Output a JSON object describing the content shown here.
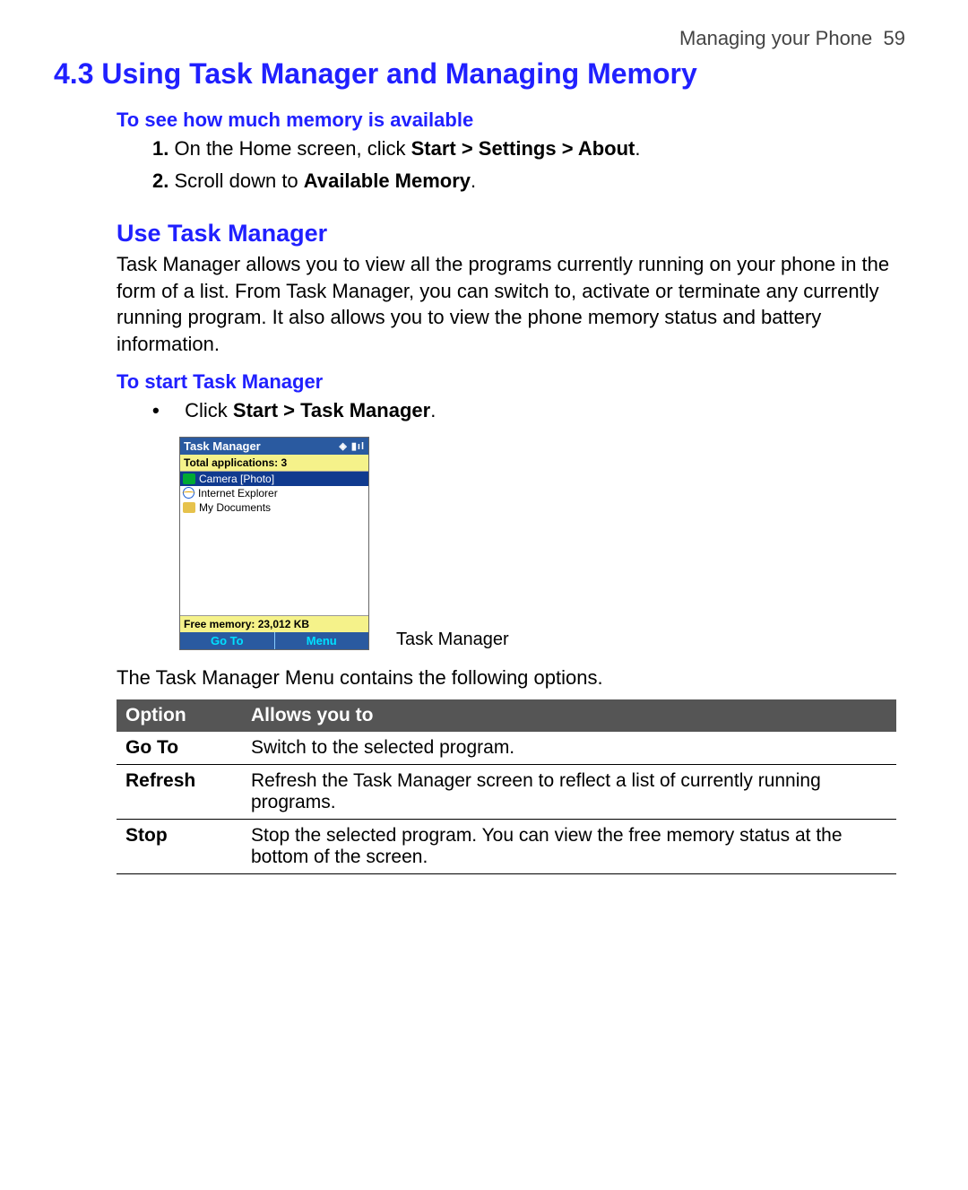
{
  "header": {
    "chapter": "Managing your Phone",
    "page_no": "59"
  },
  "title": "4.3 Using Task Manager and Managing Memory",
  "mem_check": {
    "heading": "To see how much memory is available",
    "steps": [
      {
        "num": "1.",
        "pre": "On the Home screen, click ",
        "bold": "Start > Settings > About",
        "post": "."
      },
      {
        "num": "2.",
        "pre": "Scroll down to ",
        "bold": "Available Memory",
        "post": "."
      }
    ]
  },
  "use_tm": {
    "heading": "Use Task Manager",
    "para": "Task Manager allows you to view all the programs currently running on your phone in the form of a list. From Task Manager, you can switch to, activate or terminate any currently running program. It also allows you to view the phone memory status and battery information."
  },
  "start_tm": {
    "heading": "To start Task Manager",
    "bullet_pre": "Click ",
    "bullet_bold": "Start > Task Manager",
    "bullet_post": "."
  },
  "phone": {
    "title": "Task Manager",
    "total": "Total applications: 3",
    "items": [
      "Camera [Photo]",
      "Internet Explorer",
      "My Documents"
    ],
    "free": "Free memory: 23,012 KB",
    "soft_left": "Go To",
    "soft_right": "Menu",
    "caption": "Task Manager"
  },
  "menu_intro": "The Task Manager Menu contains the following options.",
  "table": {
    "head": [
      "Option",
      "Allows you to"
    ],
    "rows": [
      {
        "opt": "Go To",
        "desc": "Switch to the selected program."
      },
      {
        "opt": "Refresh",
        "desc": "Refresh the Task Manager screen to reflect a list of currently running programs."
      },
      {
        "opt": "Stop",
        "desc": "Stop the selected program. You can view the free memory status at the bottom of the screen."
      }
    ]
  }
}
